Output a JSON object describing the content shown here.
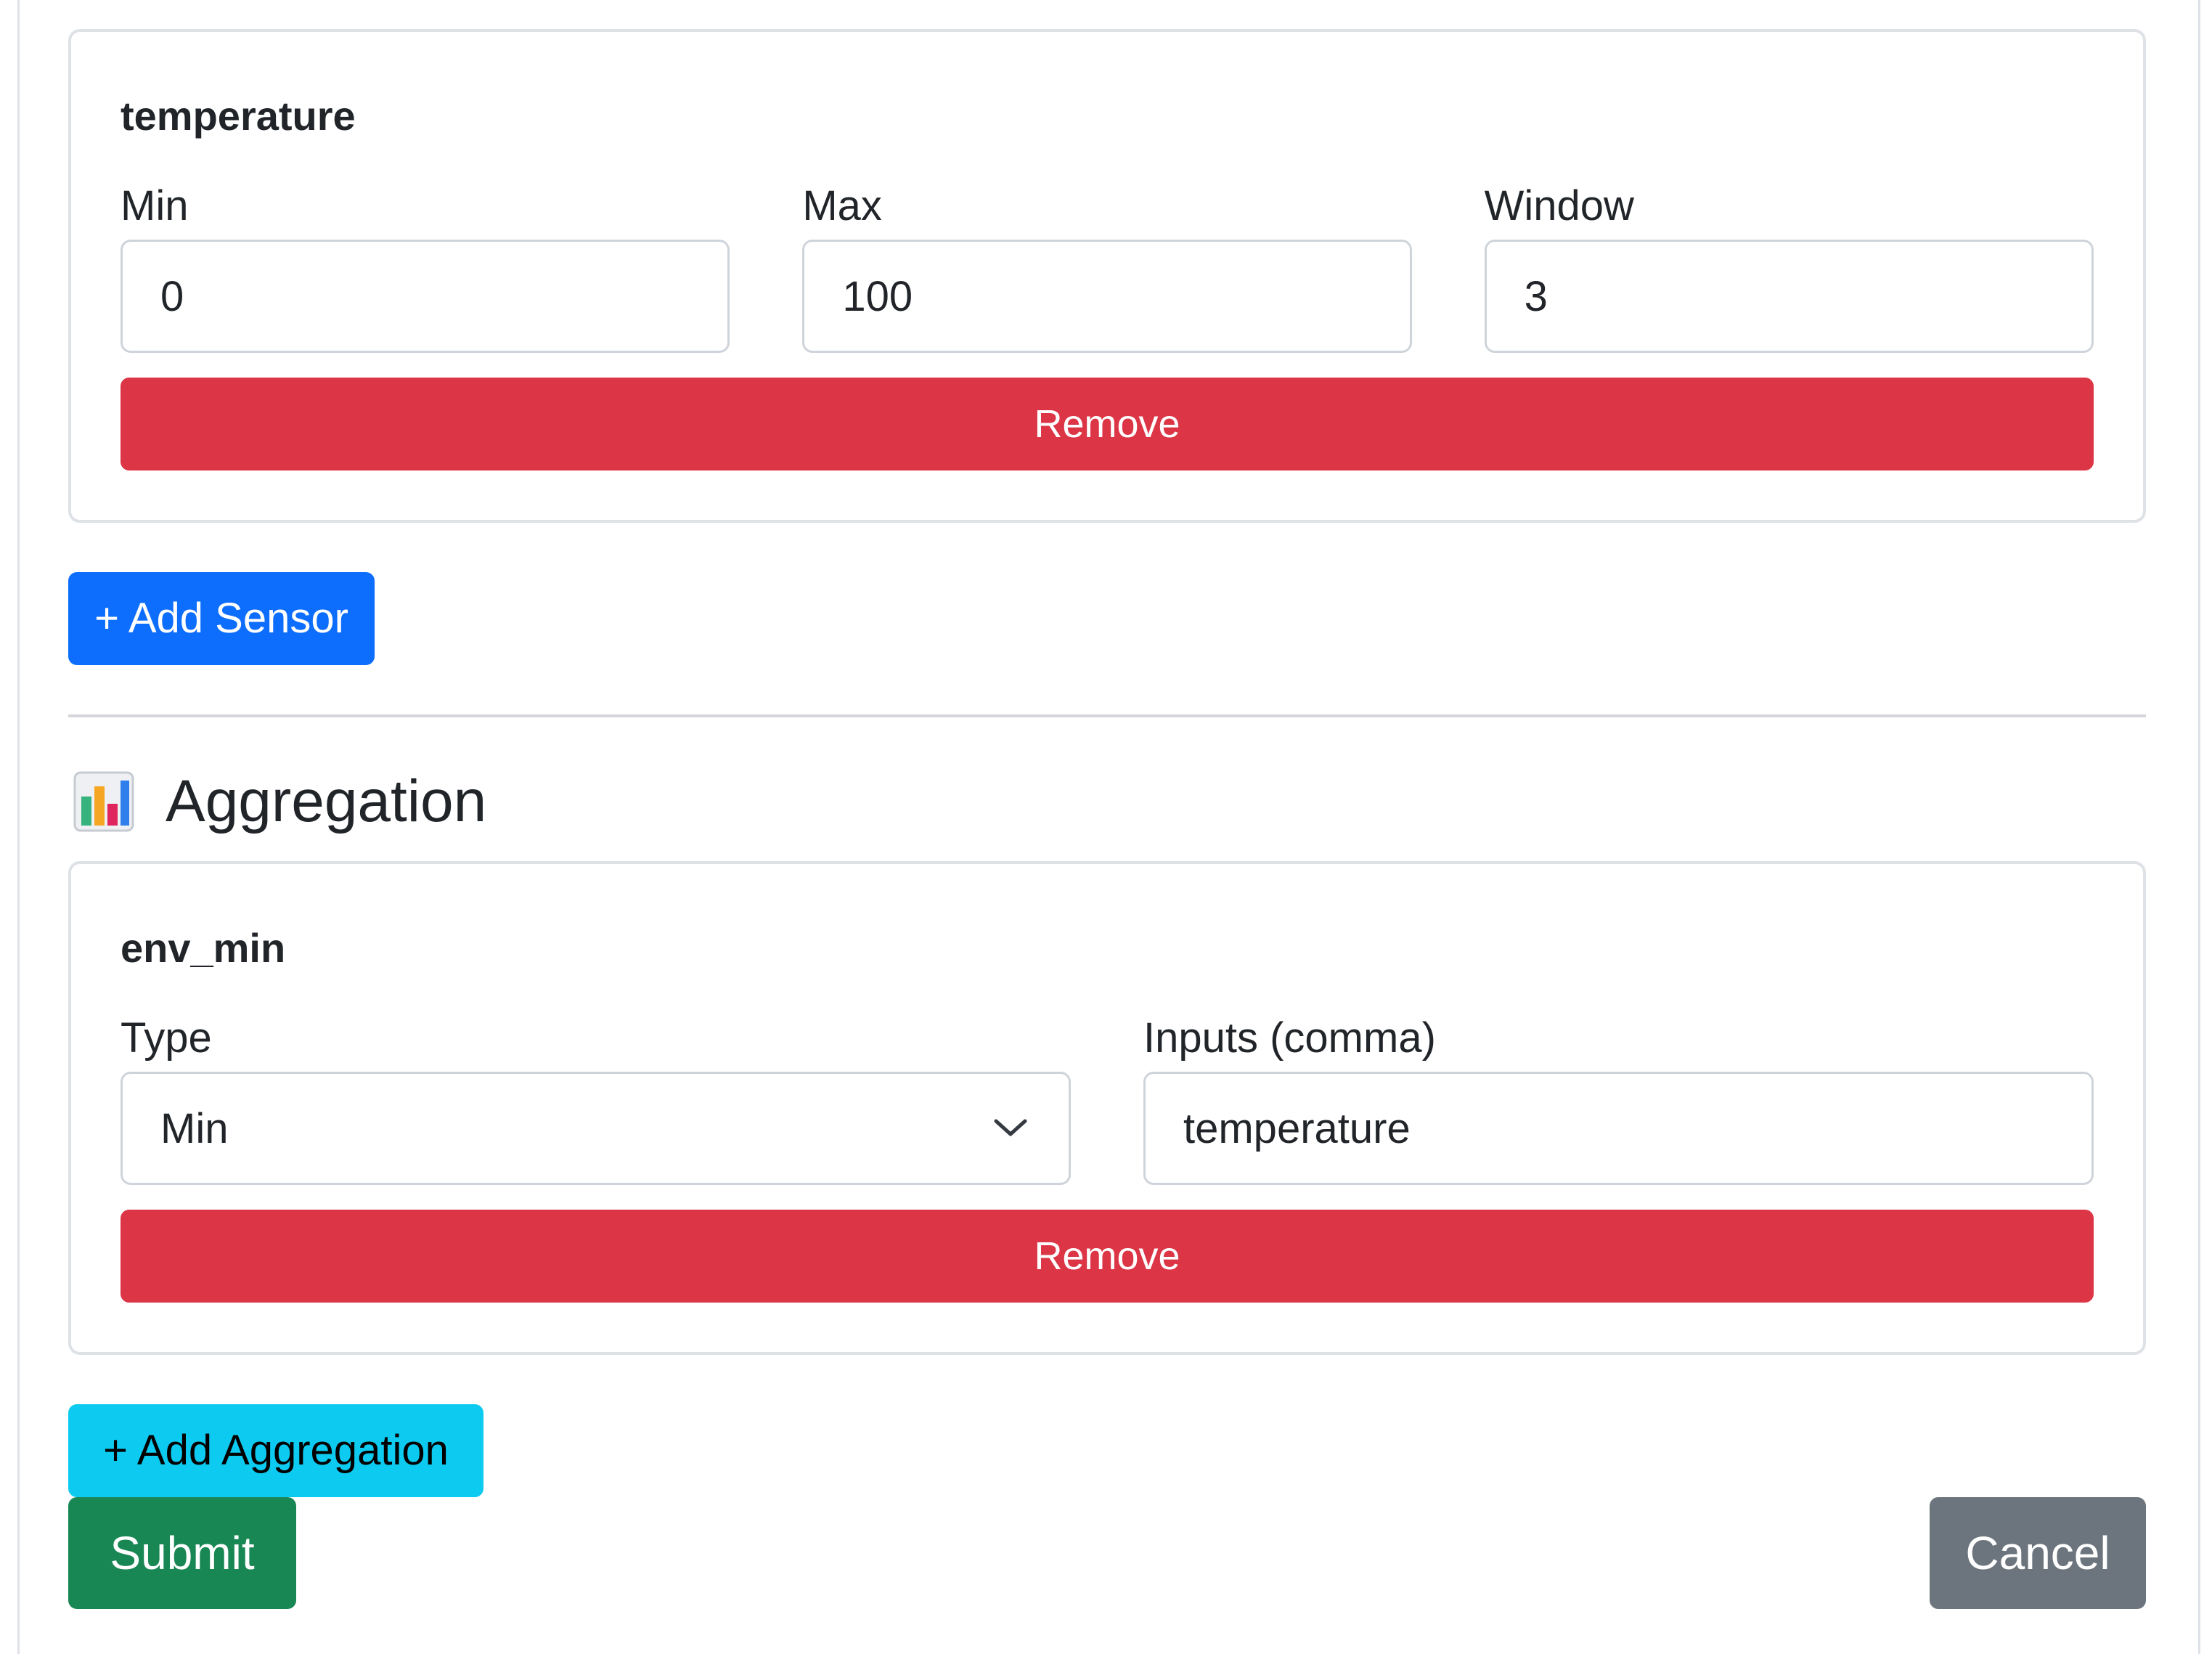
{
  "sensor_card": {
    "title": "temperature",
    "fields": [
      {
        "label": "Min",
        "value": "0"
      },
      {
        "label": "Max",
        "value": "100"
      },
      {
        "label": "Window",
        "value": "3"
      }
    ],
    "remove_label": "Remove"
  },
  "add_sensor_label": "+ Add Sensor",
  "aggregation": {
    "heading": "Aggregation",
    "icon": "bar-chart-icon",
    "card": {
      "title": "env_min",
      "type_label": "Type",
      "type_value": "Min",
      "inputs_label": "Inputs (comma)",
      "inputs_value": "temperature",
      "remove_label": "Remove"
    },
    "add_label": "+ Add Aggregation"
  },
  "footer": {
    "submit_label": "Submit",
    "cancel_label": "Cancel"
  },
  "colors": {
    "danger": "#dc3545",
    "primary": "#0d6efd",
    "info": "#0dcaf0",
    "success": "#198754",
    "secondary": "#6c757d"
  }
}
